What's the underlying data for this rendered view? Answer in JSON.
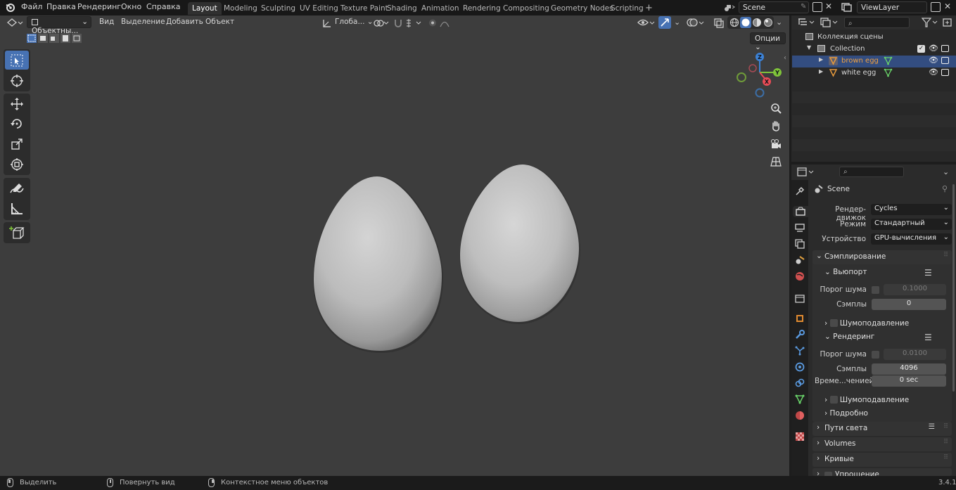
{
  "top_menu": {
    "items": [
      "Файл",
      "Правка",
      "Рендеринг",
      "Окно",
      "Справка"
    ],
    "workspaces": [
      "Layout",
      "Modeling",
      "Sculpting",
      "UV Editing",
      "Texture Paint",
      "Shading",
      "Animation",
      "Rendering",
      "Compositing",
      "Geometry Nodes",
      "Scripting"
    ],
    "active_workspace": "Layout",
    "add_workspace": "+",
    "scene": "Scene",
    "view_layer": "ViewLayer"
  },
  "viewport_header": {
    "mode": "Объектны...",
    "menus": [
      "Вид",
      "Выделение",
      "Добавить",
      "Объект"
    ],
    "orientation": "Глоба...",
    "options": "Опции"
  },
  "outliner": {
    "scene_collection": "Коллекция сцены",
    "collection": "Collection",
    "objects": [
      {
        "name": "brown egg",
        "selected": true
      },
      {
        "name": "white egg",
        "selected": false
      }
    ]
  },
  "properties": {
    "scene_name": "Scene",
    "render_engine_label": "Рендер-движок",
    "render_engine": "Cycles",
    "mode_label": "Режим",
    "mode": "Стандартный",
    "device_label": "Устройство",
    "device": "GPU-вычисления",
    "sampling": "Сэмплирование",
    "viewport": "Вьюпорт",
    "noise_threshold_label": "Порог шума",
    "viewport_noise_threshold": "0.1000",
    "samples_label": "Сэмплы",
    "viewport_samples": "0",
    "denoise": "Шумоподавление",
    "render": "Рендеринг",
    "render_noise_threshold": "0.0100",
    "render_samples": "4096",
    "time_limit_label": "Време...ченией",
    "time_limit": "0 sec",
    "advanced": "Подробно",
    "light_paths": "Пути света",
    "volumes": "Volumes",
    "curves": "Кривые",
    "simplify": "Упрощение"
  },
  "status_bar": {
    "select": "Выделить",
    "rotate_view": "Повернуть вид",
    "context_menu": "Контекстное меню объектов",
    "version": "3.4.1"
  },
  "colors": {
    "accent": "#4772b3",
    "viewport_bg": "#3d3d3d",
    "selected_row": "#334d80",
    "gizmo_x": "#e84b55",
    "gizmo_y": "#7fc33a",
    "gizmo_z": "#3c82d6"
  }
}
